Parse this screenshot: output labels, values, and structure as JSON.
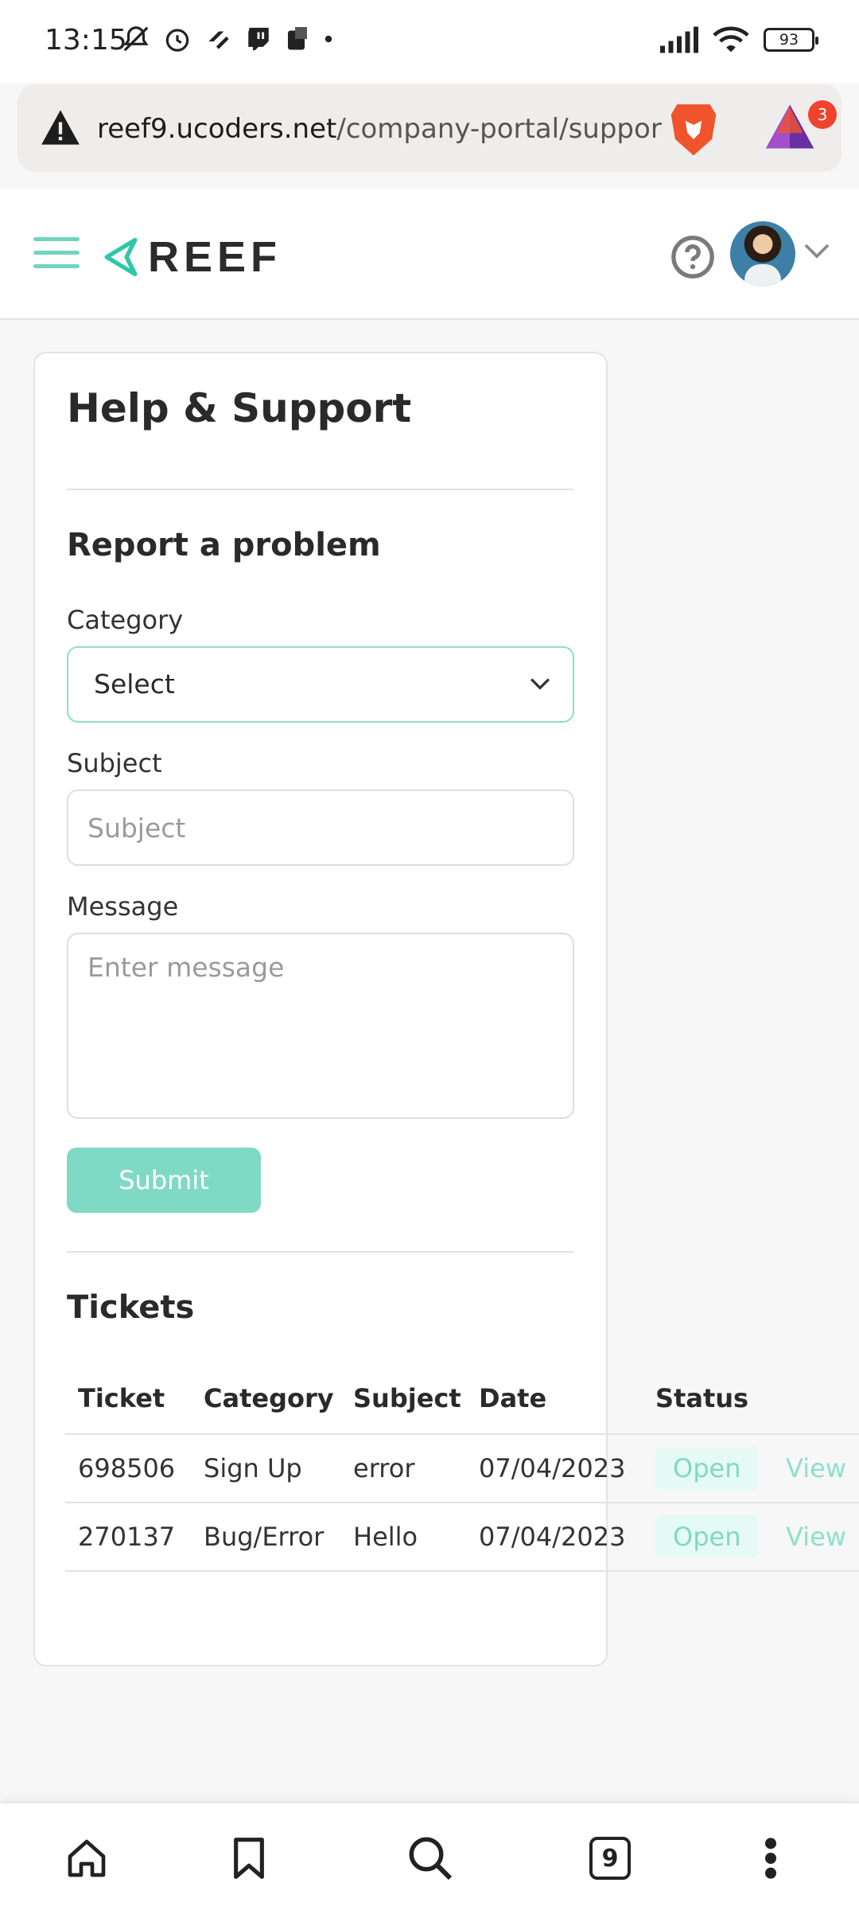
{
  "status_bar": {
    "time": "13:15",
    "battery": "93",
    "icons_left": [
      "mute-icon",
      "alarm-icon",
      "link-icon",
      "twitch-icon",
      "bag-icon",
      "dot-icon"
    ],
    "icons_right": [
      "signal-icon",
      "wifi-icon",
      "battery-icon"
    ]
  },
  "browser": {
    "url_host": "reef9.ucoders.net",
    "url_path": "/company-portal/support",
    "rewards_count": "3",
    "brand_color": "#f0542c"
  },
  "header": {
    "logo_text": "REEF",
    "accent_color": "#6fd5c0"
  },
  "card": {
    "title": "Help & Support",
    "form": {
      "section_title": "Report a problem",
      "category_label": "Category",
      "category_value": "Select",
      "subject_label": "Subject",
      "subject_placeholder": "Subject",
      "message_label": "Message",
      "message_placeholder": "Enter message",
      "submit_label": "Submit"
    },
    "tickets": {
      "title": "Tickets",
      "columns": [
        "Ticket",
        "Category",
        "Subject",
        "Date",
        "Status",
        ""
      ],
      "rows": [
        {
          "ticket": "698506",
          "category": "Sign Up",
          "subject": "error",
          "date": "07/04/2023",
          "status": "Open",
          "action": "View"
        },
        {
          "ticket": "270137",
          "category": "Bug/Error",
          "subject": "Hello",
          "date": "07/04/2023",
          "status": "Open",
          "action": "View"
        }
      ]
    }
  },
  "bottom_nav": {
    "items": [
      "home-icon",
      "bookmark-icon",
      "search-icon",
      "tabs-icon",
      "more-icon"
    ],
    "tab_count": "9"
  }
}
